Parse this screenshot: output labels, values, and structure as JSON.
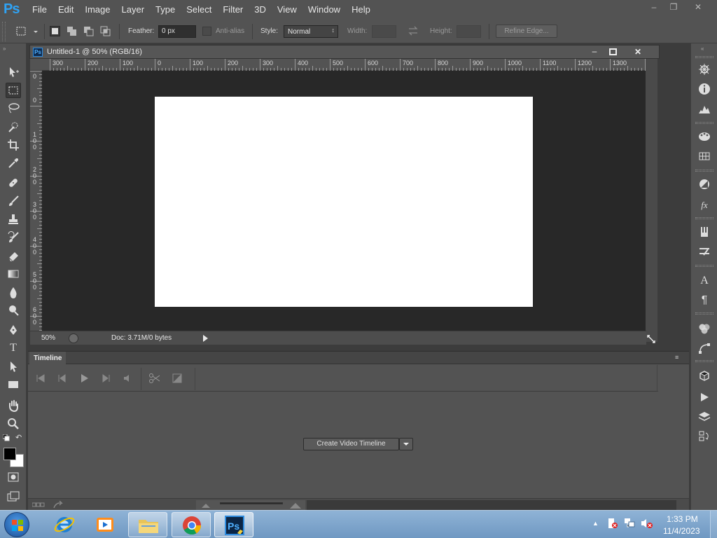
{
  "app": {
    "logo": "Ps"
  },
  "menu": [
    "File",
    "Edit",
    "Image",
    "Layer",
    "Type",
    "Select",
    "Filter",
    "3D",
    "View",
    "Window",
    "Help"
  ],
  "window_controls": {
    "minimize_icon": "minimize-icon",
    "restore_icon": "restore-icon",
    "close_icon": "close-icon"
  },
  "options_bar": {
    "feather_label": "Feather:",
    "feather_value": "0 px",
    "antialias_label": "Anti-alias",
    "style_label": "Style:",
    "style_value": "Normal",
    "width_label": "Width:",
    "height_label": "Height:",
    "refine_edge_label": "Refine Edge..."
  },
  "document": {
    "title": "Untitled-1 @ 50% (RGB/16)",
    "zoom": "50%",
    "doc_info": "Doc: 3.71M/0 bytes"
  },
  "rulers": {
    "horizontal": [
      "300",
      "200",
      "100",
      "0",
      "100",
      "200",
      "300",
      "400",
      "500",
      "600",
      "700",
      "800",
      "900",
      "1000",
      "1100",
      "1200",
      "1300"
    ],
    "vertical": [
      "0",
      "0",
      "100",
      "200",
      "300",
      "400",
      "500",
      "600"
    ]
  },
  "timeline": {
    "tab_label": "Timeline",
    "create_button_label": "Create Video Timeline"
  },
  "taskbar": {
    "time": "1:33 PM",
    "date": "11/4/2023"
  }
}
